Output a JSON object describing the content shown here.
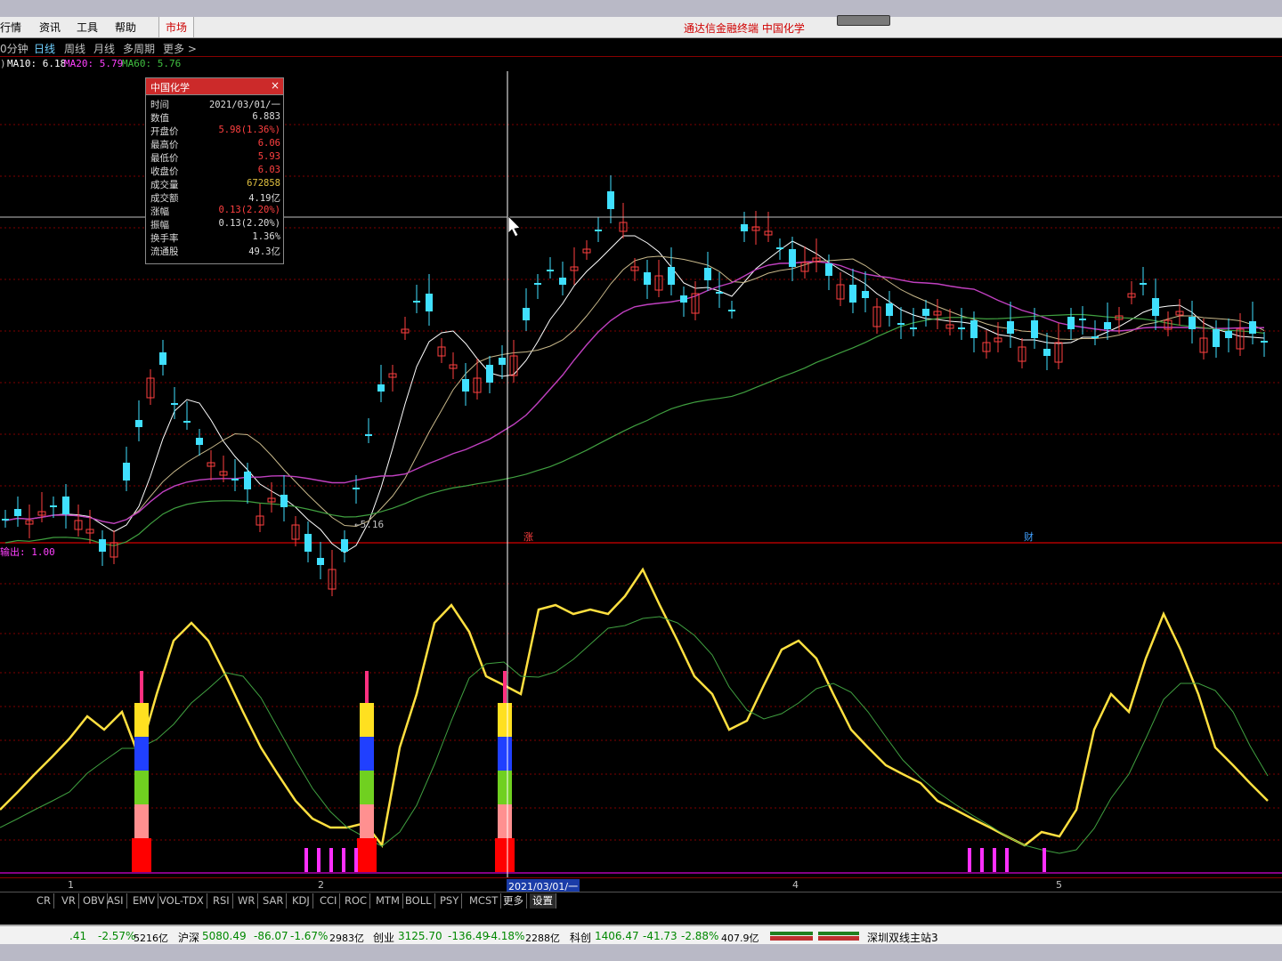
{
  "colors": {
    "up": "#ff4040",
    "down": "#40e0ff",
    "ma5": "#ffffff",
    "ma10": "#c8b88a",
    "ma20": "#c040c0",
    "ma60": "#40a040",
    "osc": "#ffe040",
    "signal": "#40a040",
    "grid": "#800000"
  },
  "menu": {
    "items": [
      "行情",
      "资讯",
      "工具",
      "帮助"
    ],
    "market": "市场",
    "title": "通达信金融终端  中国化学"
  },
  "periods": [
    "0分钟",
    "日线",
    "周线",
    "月线",
    "多周期",
    "更多 >"
  ],
  "active_period": "日线",
  "ma_legend": [
    {
      "label": "MA10: 6.18",
      "color": "#ffffff"
    },
    {
      "label": "MA20: 5.79",
      "color": "#ff40ff"
    },
    {
      "label": "MA60: 5.76",
      "color": "#40c040"
    }
  ],
  "low_marker": "←5.16",
  "flags": {
    "zhang": "涨",
    "cai": "财"
  },
  "indicator_label": "输出: 1.00",
  "tooltip": {
    "title": "中国化学",
    "close": "×",
    "rows": [
      {
        "k": "时间",
        "v": "2021/03/01/一",
        "c": "#dddddd"
      },
      {
        "k": "数值",
        "v": "6.883",
        "c": "#dddddd"
      },
      {
        "k": "开盘价",
        "v": "5.98(1.36%)",
        "c": "#ff4040"
      },
      {
        "k": "最高价",
        "v": "6.06",
        "c": "#ff4040"
      },
      {
        "k": "最低价",
        "v": "5.93",
        "c": "#ff4040"
      },
      {
        "k": "收盘价",
        "v": "6.03",
        "c": "#ff4040"
      },
      {
        "k": "成交量",
        "v": "672858",
        "c": "#e0c040"
      },
      {
        "k": "成交额",
        "v": "4.19亿",
        "c": "#dddddd"
      },
      {
        "k": "涨幅",
        "v": "0.13(2.20%)",
        "c": "#ff4040"
      },
      {
        "k": "振幅",
        "v": "0.13(2.20%)",
        "c": "#dddddd"
      },
      {
        "k": "换手率",
        "v": "1.36%",
        "c": "#dddddd"
      },
      {
        "k": "流通股",
        "v": "49.3亿",
        "c": "#dddddd"
      }
    ]
  },
  "date_axis": {
    "labels": [
      "1",
      "2",
      "4",
      "5"
    ],
    "cursor": "2021/03/01/一"
  },
  "indicator_tabs": [
    "CR",
    "VR",
    "OBV",
    "ASI",
    "EMV",
    "VOL-TDX",
    "RSI",
    "WR",
    "SAR",
    "KDJ",
    "CCI",
    "ROC",
    "MTM",
    "BOLL",
    "PSY",
    "MCST",
    "更多",
    "设置"
  ],
  "status": {
    "seg1": ".41",
    "seg1_pct": "-2.57%",
    "seg1_amt": "5216亿",
    "hs_label": "沪深",
    "hs_val": "5080.49",
    "hs_chg": "-86.07",
    "hs_pct": "-1.67%",
    "hs_amt": "2983亿",
    "cy_label": "创业",
    "cy_val": "3125.70",
    "cy_chg": "-136.49",
    "cy_pct": "-4.18%",
    "cy_amt": "2288亿",
    "kc_label": "科创",
    "kc_val": "1406.47",
    "kc_chg": "-41.73",
    "kc_pct": "-2.88%",
    "kc_amt": "407.9亿",
    "server": "深圳双线主站3"
  }
}
